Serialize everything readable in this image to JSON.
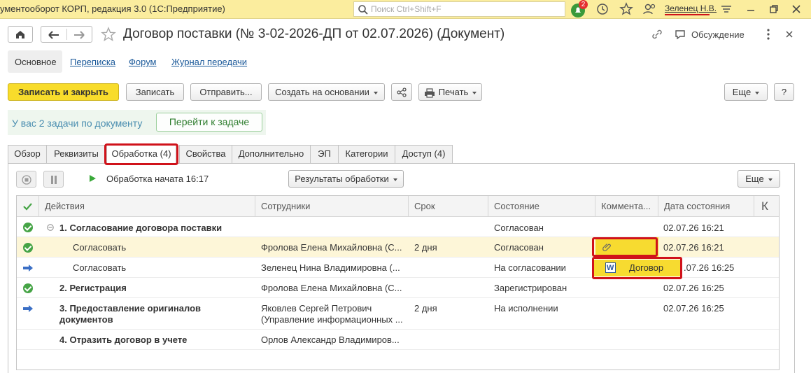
{
  "app": {
    "title": "ументооборот КОРП, редакция 3.0  (1С:Предприятие)",
    "search_placeholder": "Поиск Ctrl+Shift+F",
    "notifications_count": "2",
    "user_name": "Зеленец Н.В."
  },
  "window": {
    "title": "Договор поставки (№ 3-02-2026-ДП от 02.07.2026) (Документ)",
    "discussion_label": "Обсуждение"
  },
  "nav": {
    "items": [
      "Основное",
      "Переписка",
      "Форум",
      "Журнал передачи"
    ]
  },
  "toolbar": {
    "save_close": "Записать и закрыть",
    "save": "Записать",
    "send": "Отправить...",
    "create_based": "Создать на основании",
    "print": "Печать",
    "more": "Еще",
    "help": "?"
  },
  "task_banner": {
    "text": "У вас 2 задачи по документу",
    "button": "Перейти к задаче"
  },
  "tabs": [
    "Обзор",
    "Реквизиты",
    "Обработка (4)",
    "Свойства",
    "Дополнительно",
    "ЭП",
    "Категории",
    "Доступ (4)"
  ],
  "processing": {
    "status": "Обработка начата 16:17",
    "results_button": "Результаты обработки",
    "more": "Еще"
  },
  "table": {
    "columns": [
      "Действия",
      "Сотрудники",
      "Срок",
      "Состояние",
      "Коммента...",
      "Дата состояния",
      "К"
    ],
    "rows": [
      {
        "action": "1. Согласование договора поставки",
        "employee": "",
        "term": "",
        "state": "Согласован",
        "comment": "",
        "date": "02.07.26 16:21"
      },
      {
        "action": "Согласовать",
        "employee": "Фролова Елена Михайловна (С...",
        "term": "2 дня",
        "state": "Согласован",
        "comment": "",
        "date": "02.07.26 16:21"
      },
      {
        "action": "Согласовать",
        "employee": "Зеленец Нина Владимировна (...",
        "term": "",
        "state": "На согласовании",
        "comment": "Договор",
        "date": ".07.26 16:25"
      },
      {
        "action": "2. Регистрация",
        "employee": "Фролова Елена Михайловна (С...",
        "term": "",
        "state": "Зарегистрирован",
        "comment": "",
        "date": "02.07.26 16:25"
      },
      {
        "action": "3. Предоставление оригиналов",
        "action2": "документов",
        "employee": "Яковлев Сергей Петрович",
        "employee2": "(Управление информационных ...",
        "term": "2 дня",
        "state": "На исполнении",
        "comment": "",
        "date": "02.07.26 16:25"
      },
      {
        "action": "4. Отразить договор в учете",
        "employee": "Орлов Александр Владимиров...",
        "term": "",
        "state": "",
        "comment": "",
        "date": ""
      }
    ]
  },
  "colors": {
    "accent_yellow": "#f8dc2b",
    "highlight_red": "#d0121a",
    "link_blue": "#1c5a9a",
    "success_green": "#46a446"
  }
}
